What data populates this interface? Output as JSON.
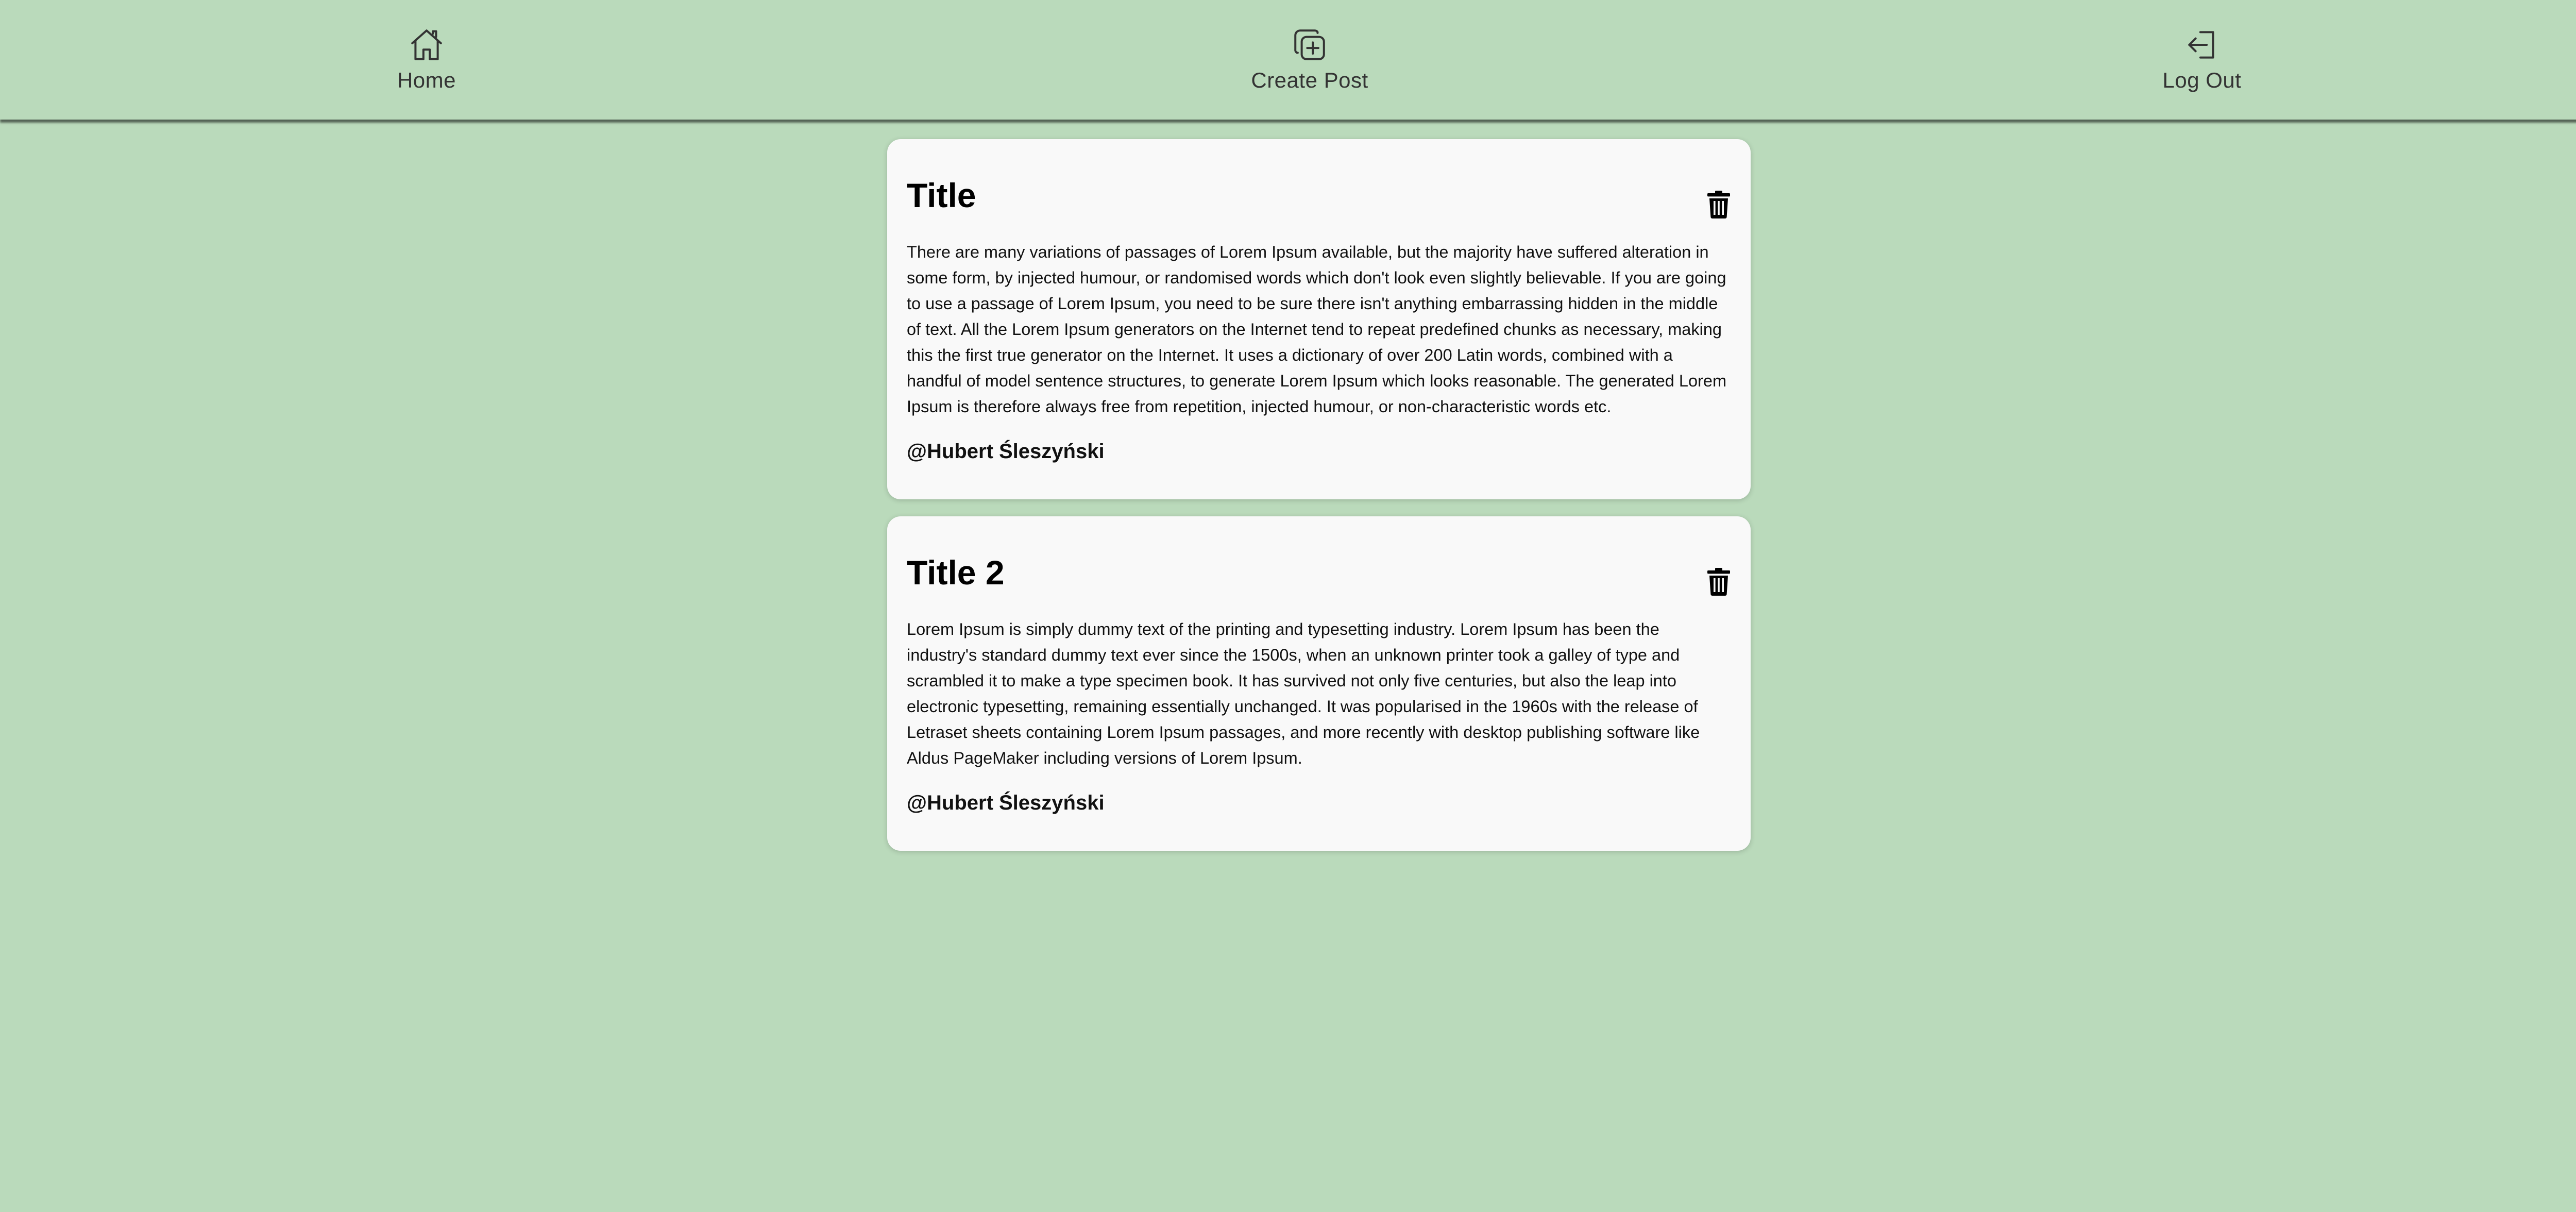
{
  "nav": {
    "home": {
      "label": "Home",
      "icon": "home-icon"
    },
    "create_post": {
      "label": "Create Post",
      "icon": "add-square-icon"
    },
    "logout": {
      "label": "Log Out",
      "icon": "logout-icon"
    }
  },
  "posts": [
    {
      "title": "Title",
      "body": "There are many variations of passages of Lorem Ipsum available, but the majority have suffered alteration in some form, by injected humour, or randomised words which don't look even slightly believable. If you are going to use a passage of Lorem Ipsum, you need to be sure there isn't anything embarrassing hidden in the middle of text. All the Lorem Ipsum generators on the Internet tend to repeat predefined chunks as necessary, making this the first true generator on the Internet. It uses a dictionary of over 200 Latin words, combined with a handful of model sentence structures, to generate Lorem Ipsum which looks reasonable. The generated Lorem Ipsum is therefore always free from repetition, injected humour, or non-characteristic words etc.",
      "author": "@Hubert Śleszyński",
      "delete_icon": "trash-icon"
    },
    {
      "title": "Title 2",
      "body": "Lorem Ipsum is simply dummy text of the printing and typesetting industry. Lorem Ipsum has been the industry's standard dummy text ever since the 1500s, when an unknown printer took a galley of type and scrambled it to make a type specimen book. It has survived not only five centuries, but also the leap into electronic typesetting, remaining essentially unchanged. It was popularised in the 1960s with the release of Letraset sheets containing Lorem Ipsum passages, and more recently with desktop publishing software like Aldus PageMaker including versions of Lorem Ipsum.",
      "author": "@Hubert Śleszyński",
      "delete_icon": "trash-icon"
    }
  ],
  "colors": {
    "background": "#badabb",
    "card": "#f9f9f9",
    "text": "#111111"
  }
}
